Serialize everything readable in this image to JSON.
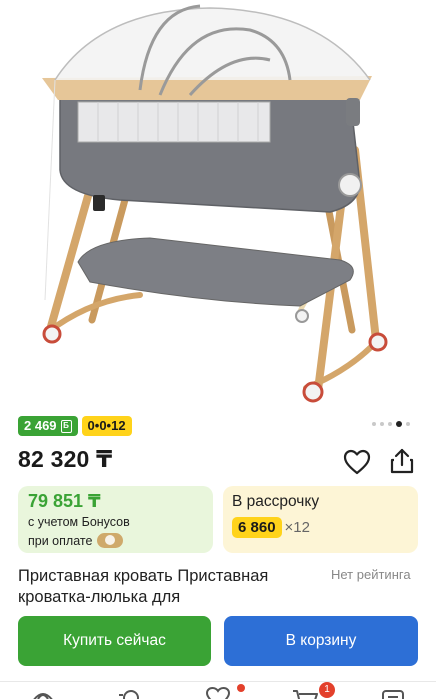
{
  "product_image": {
    "alt": ""
  },
  "badges": {
    "bonus": "2 469",
    "installment": "0•0•12"
  },
  "gallery": {
    "total": 5,
    "active": 4
  },
  "price": "82 320 ₸",
  "bonus_card": {
    "price": "79 851 ₸",
    "line1": "с учетом Бонусов",
    "line2": "при оплате"
  },
  "installment_card": {
    "title": "В рассрочку",
    "amount": "6 860",
    "months": "×12"
  },
  "product": {
    "title": "Приставная кровать Приставная кроватка-люлька для",
    "rating": "Нет рейтинга"
  },
  "actions": {
    "buy_now": "Купить сейчас",
    "add_to_cart": "В корзину"
  },
  "nav": {
    "cart_count": "1"
  },
  "colors": {
    "green": "#3aa335",
    "yellow": "#ffd31a",
    "blue": "#2d6fd6",
    "red": "#e3402b"
  }
}
